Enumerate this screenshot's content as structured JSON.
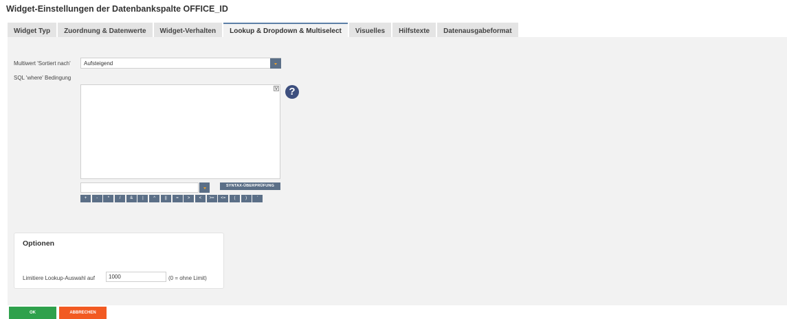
{
  "dialog": {
    "title": "Widget-Einstellungen der Datenbankspalte OFFICE_ID"
  },
  "tabs": [
    {
      "label": "Widget Typ",
      "active": false
    },
    {
      "label": "Zuordnung & Datenwerte",
      "active": false
    },
    {
      "label": "Widget-Verhalten",
      "active": false
    },
    {
      "label": "Lookup & Dropdown & Multiselect",
      "active": true
    },
    {
      "label": "Visuelles",
      "active": false
    },
    {
      "label": "Hilfstexte",
      "active": false
    },
    {
      "label": "Datenausgabeformat",
      "active": false
    }
  ],
  "sort": {
    "label": "Multiwert 'Sortiert nach'",
    "value": "Aufsteigend"
  },
  "sql": {
    "label": "SQL 'where' Bedingung",
    "value": "",
    "toggle": "V",
    "help": "?"
  },
  "syntax_button": "SYNTAX-ÜBERPRÜFUNG",
  "operators": [
    "+",
    "-",
    "*",
    "/",
    "&",
    "|",
    "^",
    "||",
    "=",
    ">",
    "<",
    ">=",
    "<=",
    "(",
    ")",
    "'"
  ],
  "options": {
    "title": "Optionen",
    "limit_label": "Limitiere Lookup-Auswahl auf",
    "limit_value": "1000",
    "limit_note": "(0 = ohne Limit)"
  },
  "buttons": {
    "ok": "OK",
    "cancel": "ABBRECHEN"
  },
  "colors": {
    "tab_active_border": "#5b7fa6",
    "control_blue": "#5b6f87",
    "ok_green": "#2fa14c",
    "cancel_orange": "#f25a22",
    "help_blue": "#3d4f7e"
  }
}
